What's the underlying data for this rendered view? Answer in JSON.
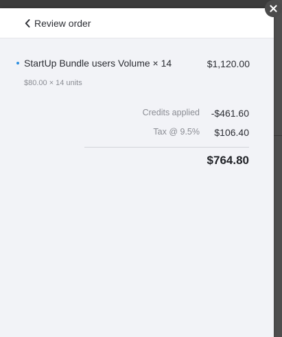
{
  "header": {
    "back_label": "Review order"
  },
  "line_items": [
    {
      "name": "StartUp Bundle users Volume × 14",
      "amount": "$1,120.00",
      "detail": "$80.00 × 14 units"
    }
  ],
  "summary": {
    "credits_label": "Credits applied",
    "credits_value": "-$461.60",
    "tax_label": "Tax @ 9.5%",
    "tax_value": "$106.40",
    "total": "$764.80"
  },
  "icons": {
    "back": "chevron-left-icon",
    "close": "close-icon"
  },
  "colors": {
    "bullet": "#2d8fe0",
    "panel_background": "#f2f3f7"
  }
}
